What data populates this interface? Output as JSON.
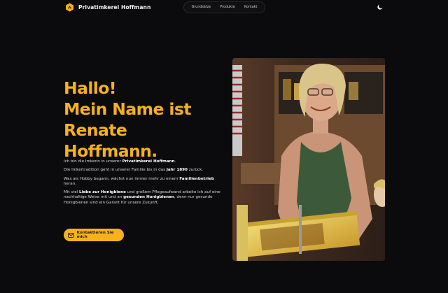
{
  "brand": {
    "name": "Privatimkerei Hoffmann",
    "logo_icon": "bee-hexagon-icon"
  },
  "nav": {
    "items": [
      {
        "label": "Grundsätze"
      },
      {
        "label": "Produkte"
      },
      {
        "label": "Kontakt"
      }
    ]
  },
  "theme_toggle": {
    "icon": "moon-icon"
  },
  "hero": {
    "headline": [
      "Hallo!",
      "Mein Name ist",
      "Renate",
      "Hoffmann."
    ],
    "p1": {
      "a": "Ich bin die Imkerin in unserer ",
      "b": "Privatimkerei Hoffmann",
      "c": "."
    },
    "p2": {
      "a": "Die Imkertradition geht in unserer Familie bis in das ",
      "b": "Jahr 1890",
      "c": " zurück."
    },
    "p3": {
      "a": "Was als Hobby begann, wächst nun immer mehr zu einem ",
      "b": "Familienbetrieb",
      "c": " heran."
    },
    "p4": {
      "a": "Mit viel ",
      "b": "Liebe zur Honigbiene",
      "c": " und großem Pflegeaufwand arbeite ich auf eine nachhaltige Weise mit und an ",
      "d": "gesunden Honigbienen",
      "e": ", denn nur gesunde Honigbienen sind ein Garant für unsere Zukunft."
    },
    "cta_label": "Kontaktieren Sie mich",
    "cta_icon": "mail-icon"
  },
  "colors": {
    "accent": "#f7b21b",
    "background": "#0b0b0d"
  }
}
